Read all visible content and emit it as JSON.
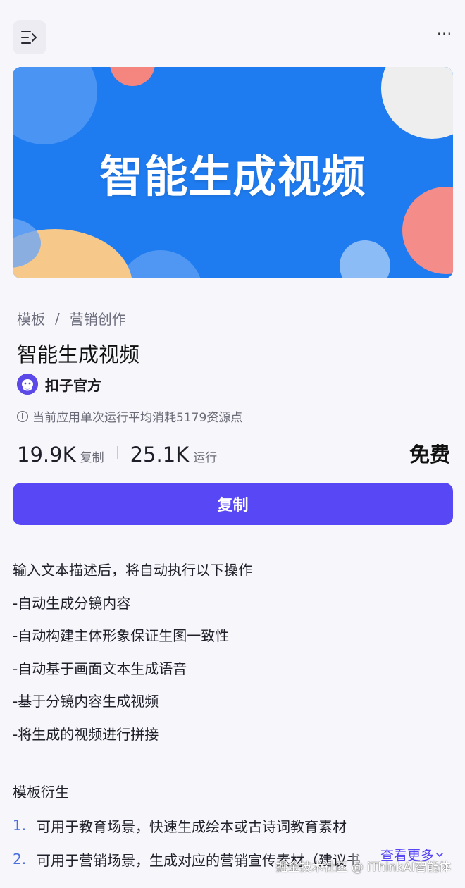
{
  "header": {
    "menu_icon": "sidebar-expand-icon",
    "more_label": "···"
  },
  "banner": {
    "title": "智能生成视频",
    "background": "#1f7cf0"
  },
  "breadcrumb": {
    "root": "模板",
    "separator": "/",
    "category": "营销创作"
  },
  "template": {
    "title": "智能生成视频",
    "author": "扣子官方",
    "cost_note": "当前应用单次运行平均消耗5179资源点",
    "copies": "19.9K",
    "copies_label": "复制",
    "runs": "25.1K",
    "runs_label": "运行",
    "price": "免费"
  },
  "actions": {
    "copy_label": "复制",
    "accent": "#5747f5"
  },
  "description": [
    "输入文本描述后，将自动执行以下操作",
    "-自动生成分镜内容",
    "-自动构建主体形象保证生图一致性",
    "-自动基于画面文本生成语音",
    "-基于分镜内容生成视频",
    "-将生成的视频进行拼接"
  ],
  "derivatives": {
    "title": "模板衍生",
    "items": [
      {
        "num": "1.",
        "text": "可用于教育场景，快速生成绘本或古诗词教育素材"
      },
      {
        "num": "2.",
        "text": "可用于营销场景，生成对应的营销宣传素材（建议书"
      }
    ],
    "see_more": "查看更多"
  },
  "watermark": "掘金技术社区 @ iThinkAI智能体"
}
